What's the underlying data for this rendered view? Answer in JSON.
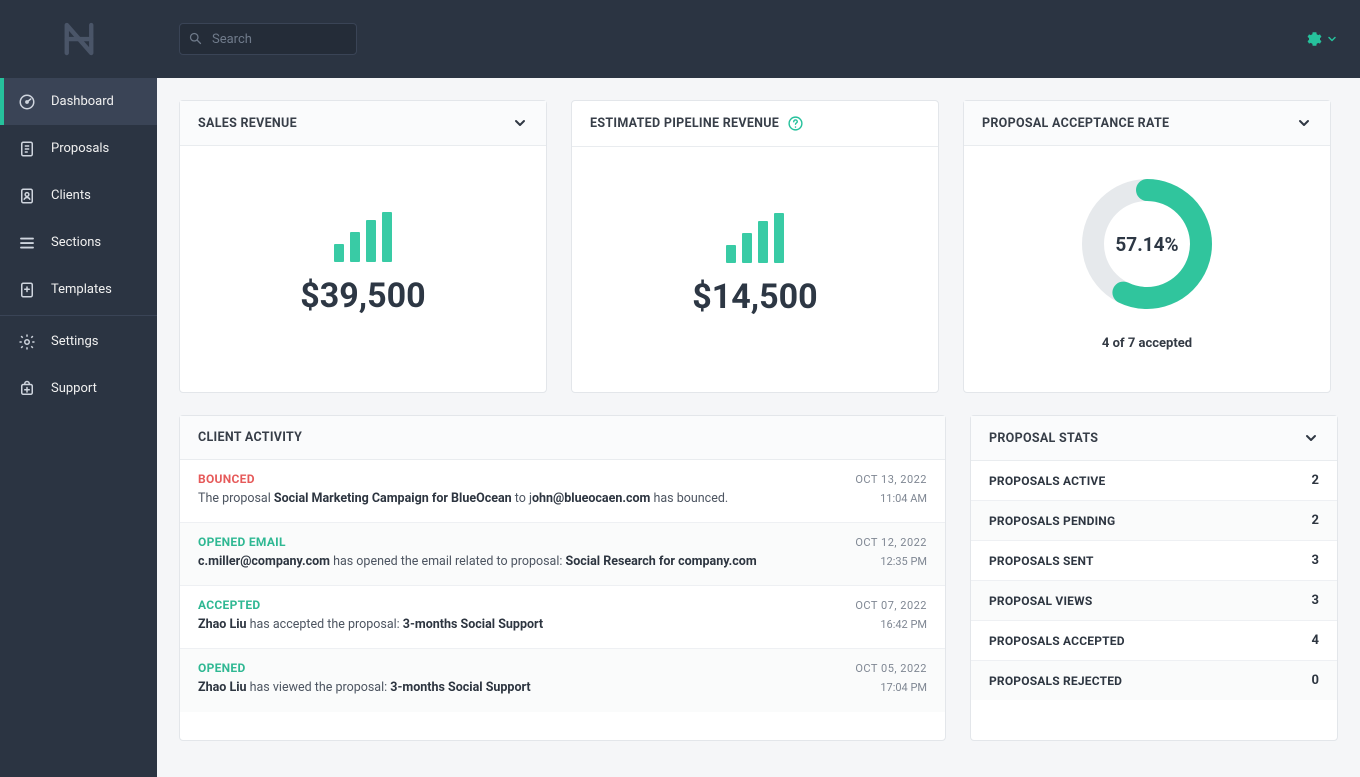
{
  "search": {
    "placeholder": "Search"
  },
  "sidebar": {
    "items": [
      {
        "label": "Dashboard",
        "name": "sidebar-item-dashboard",
        "icon": "gauge",
        "active": true
      },
      {
        "label": "Proposals",
        "name": "sidebar-item-proposals",
        "icon": "document"
      },
      {
        "label": "Clients",
        "name": "sidebar-item-clients",
        "icon": "client"
      },
      {
        "label": "Sections",
        "name": "sidebar-item-sections",
        "icon": "sections"
      },
      {
        "label": "Templates",
        "name": "sidebar-item-templates",
        "icon": "template"
      }
    ],
    "bottom": [
      {
        "label": "Settings",
        "name": "sidebar-item-settings",
        "icon": "gear"
      },
      {
        "label": "Support",
        "name": "sidebar-item-support",
        "icon": "support"
      }
    ]
  },
  "cards": {
    "salesRevenue": {
      "title": "SALES REVENUE",
      "value": "$39,500"
    },
    "pipelineRevenue": {
      "title": "ESTIMATED PIPELINE REVENUE",
      "value": "$14,500"
    },
    "acceptance": {
      "title": "PROPOSAL ACCEPTANCE RATE",
      "percent_label": "57.14%",
      "percent_value": 57.14,
      "caption": "4 of 7 accepted"
    },
    "clientActivity": {
      "title": "CLIENT ACTIVITY",
      "items": [
        {
          "status": "BOUNCED",
          "status_class": "bounced",
          "date": "OCT 13, 2022",
          "time": "11:04 AM",
          "pre": "The proposal ",
          "bold1": "Social Marketing Campaign for BlueOcean",
          "mid": " to j",
          "bold2": "ohn@blueocaen.com",
          "post": " has bounced."
        },
        {
          "status": "OPENED EMAIL",
          "status_class": "opened-email",
          "date": "OCT 12, 2022",
          "time": "12:35 PM",
          "pre": "",
          "bold1": "c.miller@company.com",
          "mid": " has opened the email related to proposal: ",
          "bold2": "Social Research for company.com",
          "post": ""
        },
        {
          "status": "ACCEPTED",
          "status_class": "accepted",
          "date": "OCT 07, 2022",
          "time": "16:42 PM",
          "pre": "",
          "bold1": "Zhao Liu",
          "mid": " has accepted the proposal: ",
          "bold2": "3-months Social Support",
          "post": ""
        },
        {
          "status": "OPENED",
          "status_class": "opened",
          "date": "OCT 05, 2022",
          "time": "17:04 PM",
          "pre": "",
          "bold1": "Zhao Liu",
          "mid": " has viewed the proposal: ",
          "bold2": "3-months Social Support",
          "post": ""
        }
      ]
    },
    "proposalStats": {
      "title": "PROPOSAL STATS",
      "rows": [
        {
          "label": "PROPOSALS ACTIVE",
          "value": "2"
        },
        {
          "label": "PROPOSALS PENDING",
          "value": "2"
        },
        {
          "label": "PROPOSALS SENT",
          "value": "3"
        },
        {
          "label": "PROPOSAL VIEWS",
          "value": "3"
        },
        {
          "label": "PROPOSALS ACCEPTED",
          "value": "4"
        },
        {
          "label": "PROPOSALS REJECTED",
          "value": "0"
        }
      ]
    }
  },
  "chart_data": [
    {
      "type": "bar",
      "title": "Sales Revenue icon",
      "categories": [
        "1",
        "2",
        "3",
        "4"
      ],
      "values": [
        18,
        30,
        42,
        50
      ]
    },
    {
      "type": "bar",
      "title": "Estimated Pipeline Revenue icon",
      "categories": [
        "1",
        "2",
        "3",
        "4"
      ],
      "values": [
        18,
        30,
        42,
        50
      ]
    },
    {
      "type": "pie",
      "title": "Proposal Acceptance Rate",
      "categories": [
        "Accepted",
        "Other"
      ],
      "values": [
        57.14,
        42.86
      ]
    }
  ]
}
